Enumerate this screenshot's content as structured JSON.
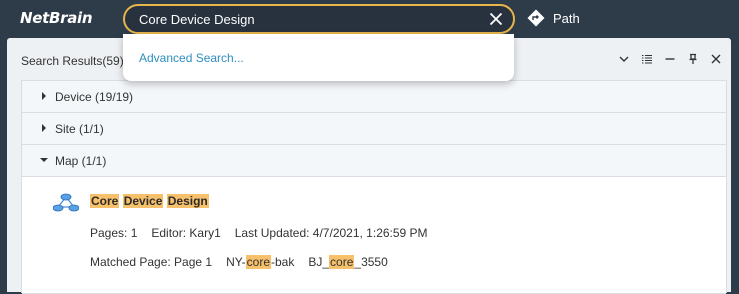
{
  "app": {
    "logo_text": "NetBrain"
  },
  "search": {
    "value": "Core Device Design",
    "placeholder": ""
  },
  "path_button": {
    "label": "Path"
  },
  "dropdown": {
    "advanced_label": "Advanced Search..."
  },
  "panel": {
    "title": "Search Results(59)",
    "tools": [
      "chevron-down-icon",
      "list-icon",
      "minimize-icon",
      "pin-icon",
      "close-icon"
    ]
  },
  "categories": [
    {
      "label": "Device (19/19)",
      "expanded": false
    },
    {
      "label": "Site (1/1)",
      "expanded": false
    },
    {
      "label": "Map (1/1)",
      "expanded": true
    }
  ],
  "map_result": {
    "title_parts": [
      {
        "text": "Core",
        "highlight": true
      },
      {
        "text": " ",
        "highlight": false
      },
      {
        "text": "Device",
        "highlight": true
      },
      {
        "text": " ",
        "highlight": false
      },
      {
        "text": "Design",
        "highlight": true
      }
    ],
    "pages": "Pages: 1",
    "editor": "Editor: Kary1",
    "last_updated": "Last Updated: 4/7/2021, 1:26:59 PM",
    "matched_page": "Matched Page: Page 1",
    "match1_pre": "NY-",
    "match1_hl": "core",
    "match1_post": "-bak",
    "match2_pre": "BJ_",
    "match2_hl": "core",
    "match2_post": "_3550"
  },
  "colors": {
    "accent": "#e8b54a",
    "highlight": "#f7c06a",
    "link": "#2f8fc0",
    "topbar": "#2e3b49"
  }
}
